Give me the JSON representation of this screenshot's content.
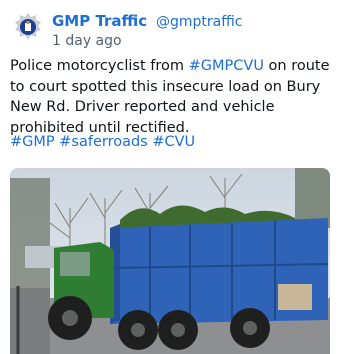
{
  "post": {
    "display_name": "GMP Traffic",
    "handle": "@gmptraffic",
    "time": "1 day ago",
    "text_before_link": "Police motorcyclist from ",
    "link_text": "#GMPCVU",
    "text_after_link": " on route to court spotted this insecure load on Bury New Rd.  Driver reported and vehicle prohibited until rectified.",
    "hashtags": [
      "#GMP",
      "#saferroads",
      "#CVU"
    ]
  },
  "icons": {
    "avatar": "police-crest-icon"
  },
  "colors": {
    "link": "#1d6fd8",
    "name": "#1f6fd1",
    "muted": "#536471",
    "trailer": "#2f63b8",
    "tractor": "#2e7d32"
  }
}
